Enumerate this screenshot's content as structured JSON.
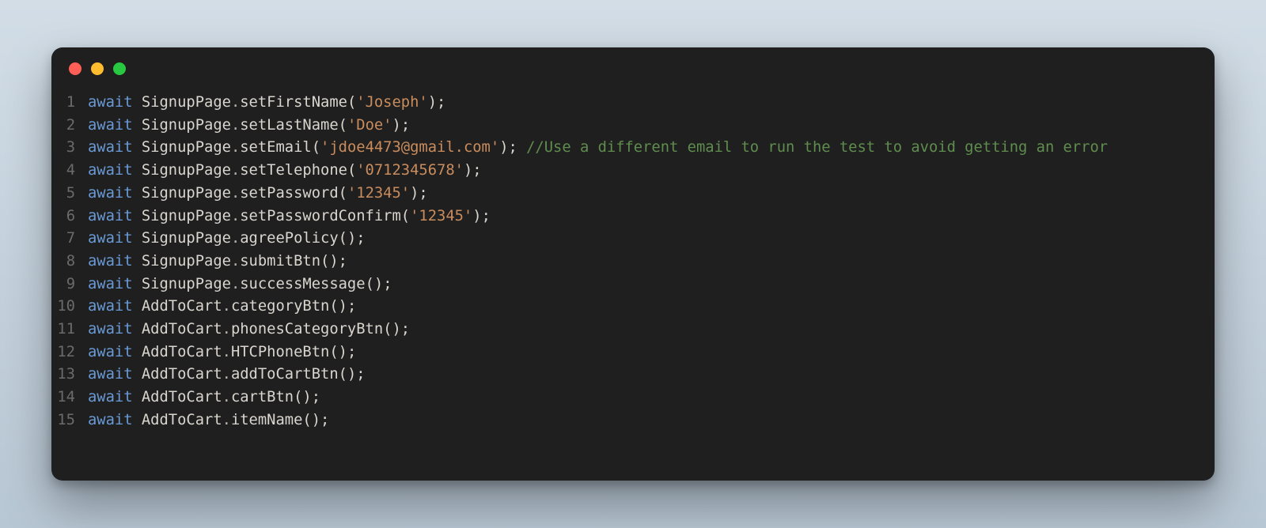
{
  "window": {
    "traffic_light_colors": {
      "close": "#ff5f57",
      "minimize": "#febc2e",
      "maximize": "#28c840"
    }
  },
  "syntax": {
    "await_keyword": "await"
  },
  "code_lines": [
    {
      "n": "1",
      "obj": "SignupPage",
      "fn": "setFirstName",
      "arg": "'Joseph'",
      "comment": ""
    },
    {
      "n": "2",
      "obj": "SignupPage",
      "fn": "setLastName",
      "arg": "'Doe'",
      "comment": ""
    },
    {
      "n": "3",
      "obj": "SignupPage",
      "fn": "setEmail",
      "arg": "'jdoe4473@gmail.com'",
      "comment": "//Use a different email to run the test to avoid getting an error"
    },
    {
      "n": "4",
      "obj": "SignupPage",
      "fn": "setTelephone",
      "arg": "'0712345678'",
      "comment": ""
    },
    {
      "n": "5",
      "obj": "SignupPage",
      "fn": "setPassword",
      "arg": "'12345'",
      "comment": ""
    },
    {
      "n": "6",
      "obj": "SignupPage",
      "fn": "setPasswordConfirm",
      "arg": "'12345'",
      "comment": ""
    },
    {
      "n": "7",
      "obj": "SignupPage",
      "fn": "agreePolicy",
      "arg": "",
      "comment": ""
    },
    {
      "n": "8",
      "obj": "SignupPage",
      "fn": "submitBtn",
      "arg": "",
      "comment": ""
    },
    {
      "n": "9",
      "obj": "SignupPage",
      "fn": "successMessage",
      "arg": "",
      "comment": ""
    },
    {
      "n": "10",
      "obj": "AddToCart",
      "fn": "categoryBtn",
      "arg": "",
      "comment": ""
    },
    {
      "n": "11",
      "obj": "AddToCart",
      "fn": "phonesCategoryBtn",
      "arg": "",
      "comment": ""
    },
    {
      "n": "12",
      "obj": "AddToCart",
      "fn": "HTCPhoneBtn",
      "arg": "",
      "comment": ""
    },
    {
      "n": "13",
      "obj": "AddToCart",
      "fn": "addToCartBtn",
      "arg": "",
      "comment": ""
    },
    {
      "n": "14",
      "obj": "AddToCart",
      "fn": "cartBtn",
      "arg": "",
      "comment": ""
    },
    {
      "n": "15",
      "obj": "AddToCart",
      "fn": "itemName",
      "arg": "",
      "comment": ""
    }
  ]
}
